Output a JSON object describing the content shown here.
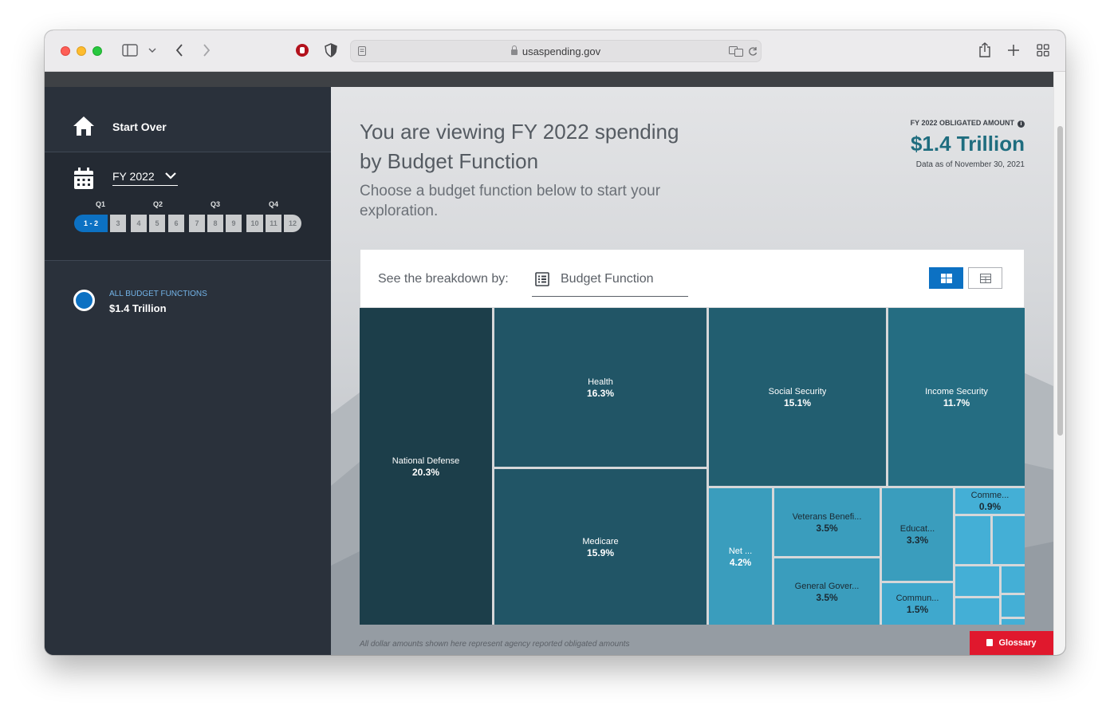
{
  "browser": {
    "url": "usaspending.gov"
  },
  "sidebar": {
    "start_over": "Start Over",
    "fiscal_year": "FY 2022",
    "quarters": [
      "Q1",
      "Q2",
      "Q3",
      "Q4"
    ],
    "periods": [
      "1 - 2",
      "3",
      "4",
      "5",
      "6",
      "7",
      "8",
      "9",
      "10",
      "11",
      "12"
    ],
    "active_period": "1 - 2",
    "budget_functions_label": "ALL BUDGET FUNCTIONS",
    "budget_functions_amount": "$1.4 Trillion"
  },
  "main": {
    "heading": "You are viewing FY 2022 spending by Budget Function",
    "subheading": "Choose a budget function below to start your exploration.",
    "obligated_label": "FY 2022 OBLIGATED AMOUNT",
    "obligated_amount": "$1.4 Trillion",
    "data_date": "Data as of November 30, 2021",
    "breakdown_label": "See the breakdown by:",
    "breakdown_value": "Budget Function",
    "footnote": "All dollar amounts shown here represent agency reported obligated amounts",
    "glossary": "Glossary"
  },
  "treemap": {
    "tiles": [
      {
        "name": "National Defense",
        "pct": "20.3%",
        "color": "#1c3e4a"
      },
      {
        "name": "Health",
        "pct": "16.3%",
        "color": "#215566"
      },
      {
        "name": "Medicare",
        "pct": "15.9%",
        "color": "#215566"
      },
      {
        "name": "Social Security",
        "pct": "15.1%",
        "color": "#225e70"
      },
      {
        "name": "Income Security",
        "pct": "11.7%",
        "color": "#256d82"
      },
      {
        "name": "Net ...",
        "pct": "4.2%",
        "color": "#3a9dbd"
      },
      {
        "name": "Veterans Benefi...",
        "pct": "3.5%",
        "color": "#3a9dbd"
      },
      {
        "name": "General Gover...",
        "pct": "3.5%",
        "color": "#3a9dbd"
      },
      {
        "name": "Educat...",
        "pct": "3.3%",
        "color": "#3a9dbd"
      },
      {
        "name": "Commun...",
        "pct": "1.5%",
        "color": "#3fa8cd"
      },
      {
        "name": "Comme...",
        "pct": "0.9%",
        "color": "#44afd6"
      }
    ]
  }
}
